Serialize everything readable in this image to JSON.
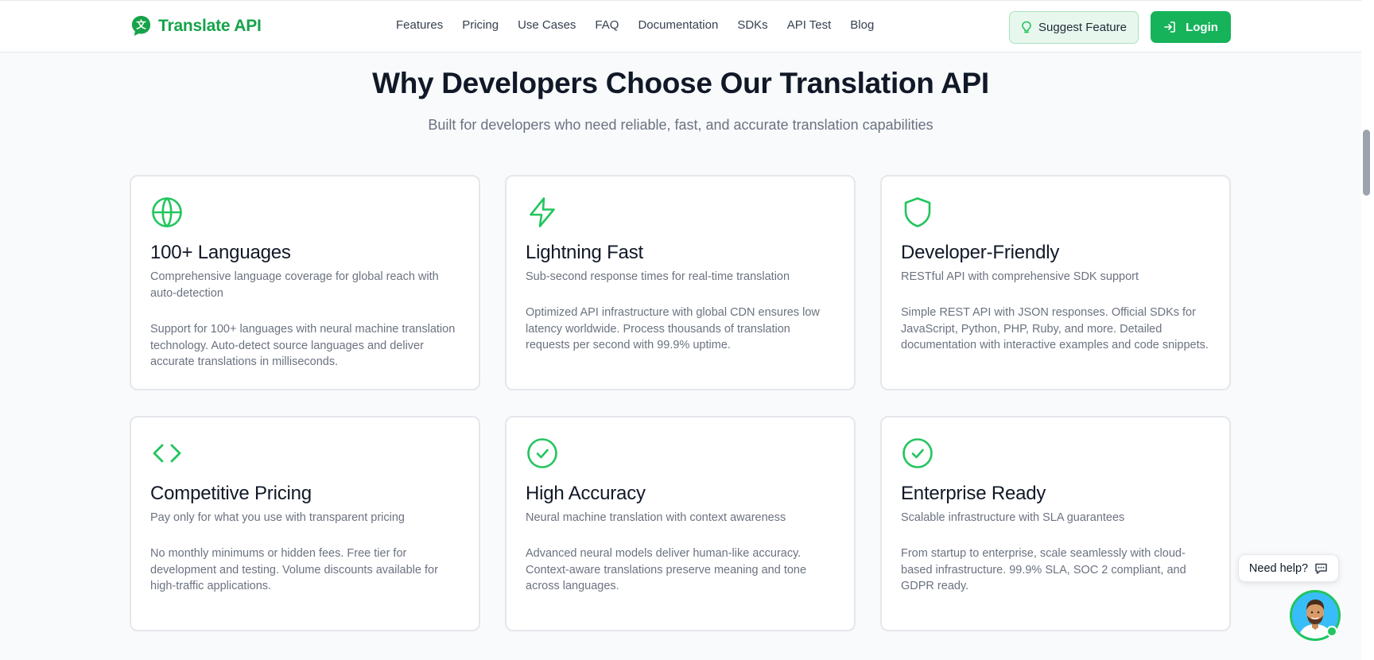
{
  "header": {
    "brand": "Translate API",
    "nav": [
      "Features",
      "Pricing",
      "Use Cases",
      "FAQ",
      "Documentation",
      "SDKs",
      "API Test",
      "Blog"
    ],
    "suggest_label": "Suggest Feature",
    "login_label": "Login"
  },
  "section": {
    "title": "Why Developers Choose Our Translation API",
    "subtitle": "Built for developers who need reliable, fast, and accurate translation capabilities"
  },
  "cards": [
    {
      "icon": "globe-icon",
      "title": "100+ Languages",
      "subtitle": "Comprehensive language coverage for global reach with auto-detection",
      "body": "Support for 100+ languages with neural machine translation technology. Auto-detect source languages and deliver accurate translations in milliseconds."
    },
    {
      "icon": "lightning-icon",
      "title": "Lightning Fast",
      "subtitle": "Sub-second response times for real-time translation",
      "body": "Optimized API infrastructure with global CDN ensures low latency worldwide. Process thousands of translation requests per second with 99.9% uptime."
    },
    {
      "icon": "shield-icon",
      "title": "Developer-Friendly",
      "subtitle": "RESTful API with comprehensive SDK support",
      "body": "Simple REST API with JSON responses. Official SDKs for JavaScript, Python, PHP, Ruby, and more. Detailed documentation with interactive examples and code snippets."
    },
    {
      "icon": "code-icon",
      "title": "Competitive Pricing",
      "subtitle": "Pay only for what you use with transparent pricing",
      "body": "No monthly minimums or hidden fees. Free tier for development and testing. Volume discounts available for high-traffic applications."
    },
    {
      "icon": "check-circle-icon",
      "title": "High Accuracy",
      "subtitle": "Neural machine translation with context awareness",
      "body": "Advanced neural models deliver human-like accuracy. Context-aware translations preserve meaning and tone across languages."
    },
    {
      "icon": "check-circle-icon",
      "title": "Enterprise Ready",
      "subtitle": "Scalable infrastructure with SLA guarantees",
      "body": "From startup to enterprise, scale seamlessly with cloud-based infrastructure. 99.9% SLA, SOC 2 compliant, and GDPR ready."
    }
  ],
  "help": {
    "label": "Need help?"
  },
  "colors": {
    "accent": "#16a34a",
    "button": "#16b35a",
    "icon": "#22c55e"
  }
}
